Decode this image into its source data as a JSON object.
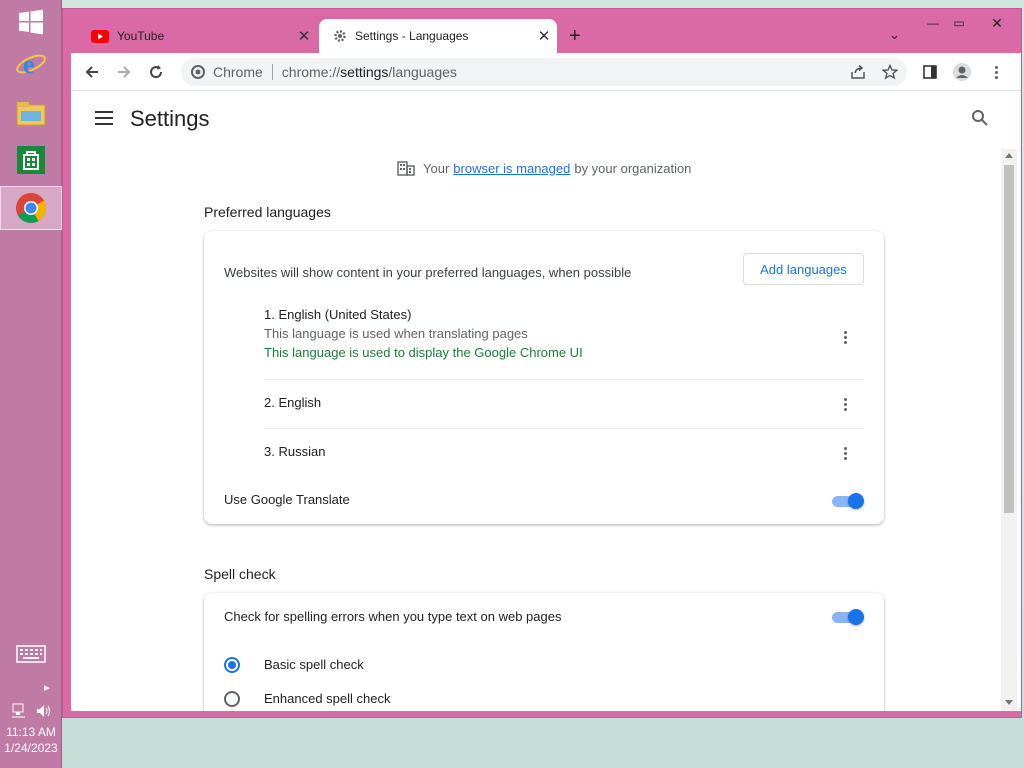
{
  "taskbar": {
    "time": "11:13 AM",
    "date": "1/24/2023"
  },
  "tabs": [
    {
      "title": "YouTube",
      "icon": "youtube-icon"
    },
    {
      "title": "Settings - Languages",
      "icon": "gear-icon"
    }
  ],
  "omnibox": {
    "chip": "Chrome",
    "url_scheme": "chrome://",
    "url_host": "settings",
    "url_path": "/languages"
  },
  "header": {
    "title": "Settings"
  },
  "managed": {
    "prefix": "Your",
    "link": "browser is managed",
    "suffix": "by your organization"
  },
  "preferred_languages": {
    "title": "Preferred languages",
    "description": "Websites will show content in your preferred languages, when possible",
    "add_button": "Add languages",
    "languages": [
      {
        "name": "1. English (United States)",
        "note1": "This language is used when translating pages",
        "note2": "This language is used to display the Google Chrome UI"
      },
      {
        "name": "2. English"
      },
      {
        "name": "3. Russian"
      }
    ],
    "translate_label": "Use Google Translate",
    "translate_on": true
  },
  "spell_check": {
    "title": "Spell check",
    "toggle_label": "Check for spelling errors when you type text on web pages",
    "toggle_on": true,
    "options": [
      {
        "label": "Basic spell check",
        "selected": true
      },
      {
        "label": "Enhanced spell check",
        "selected": false
      }
    ]
  },
  "colors": {
    "window_frame": "#d96aa6",
    "taskbar": "#c07aa6",
    "accent": "#1a73e8"
  }
}
